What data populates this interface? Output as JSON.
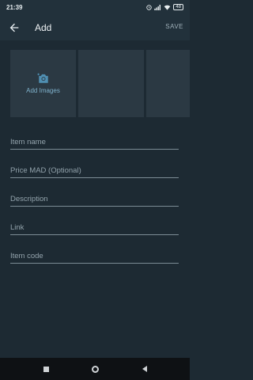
{
  "status_bar": {
    "time": "21:39",
    "battery": "48"
  },
  "app_bar": {
    "title": "Add",
    "save_label": "SAVE"
  },
  "images": {
    "add_label": "Add Images",
    "tile_count": 3
  },
  "form": {
    "fields": [
      {
        "name": "item-name-field",
        "placeholder": "Item name"
      },
      {
        "name": "price-field",
        "placeholder": "Price MAD (Optional)"
      },
      {
        "name": "description-field",
        "placeholder": "Description"
      },
      {
        "name": "link-field",
        "placeholder": "Link"
      },
      {
        "name": "item-code-field",
        "placeholder": "Item code"
      }
    ]
  },
  "colors": {
    "background": "#1d2a33",
    "accent": "#7fb2cc"
  }
}
